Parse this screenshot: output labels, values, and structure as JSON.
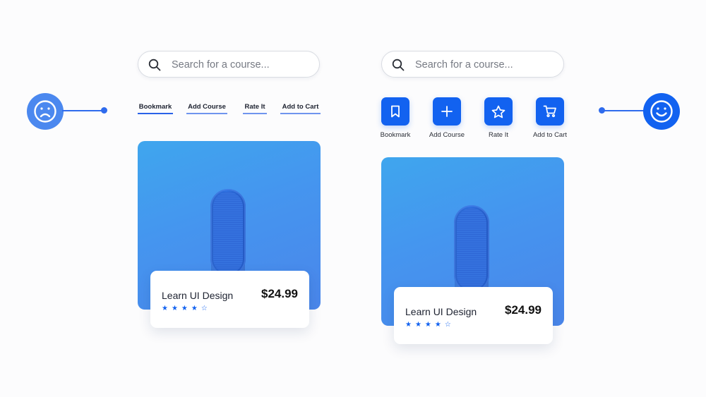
{
  "left": {
    "search": {
      "placeholder": "Search for a course..."
    },
    "links": [
      "Bookmark",
      "Add Course",
      "Rate It",
      "Add to Cart"
    ],
    "card": {
      "title": "Learn UI Design",
      "price": "$24.99",
      "stars": "★★★★☆",
      "rating": 4,
      "max_rating": 5
    }
  },
  "right": {
    "search": {
      "placeholder": "Search for a course..."
    },
    "actions": [
      {
        "label": "Bookmark",
        "icon": "bookmark-icon"
      },
      {
        "label": "Add Course",
        "icon": "plus-icon"
      },
      {
        "label": "Rate It",
        "icon": "star-icon"
      },
      {
        "label": "Add to Cart",
        "icon": "cart-icon"
      }
    ],
    "card": {
      "title": "Learn UI Design",
      "price": "$24.99",
      "stars": "★★★★☆",
      "rating": 4,
      "max_rating": 5
    }
  },
  "faces": {
    "sad": "sad-face-icon",
    "happy": "happy-face-icon"
  },
  "colors": {
    "accent": "#1262f0",
    "face_sad": "#4b88ef",
    "face_happy": "#1262f0"
  }
}
